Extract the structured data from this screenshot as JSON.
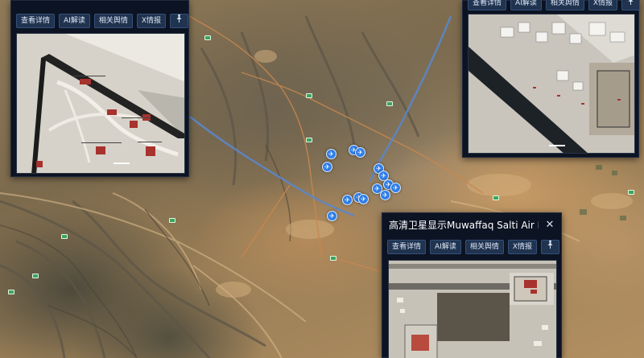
{
  "popups": {
    "top_left": {
      "title": "",
      "buttons": {
        "details": "查看详情",
        "ai": "AI解读",
        "sentiment": "相关舆情",
        "intel": "X情报"
      },
      "icons": {
        "pin": "pin-icon"
      }
    },
    "top_right": {
      "title": "",
      "buttons": {
        "details": "查看详情",
        "ai": "AI解读",
        "sentiment": "相关舆情",
        "intel": "X情报"
      },
      "icons": {
        "pin": "pin-icon"
      }
    },
    "bottom": {
      "title": "高清卫星显示Muwaffaq Salti Air Bas...",
      "close_symbol": "✕",
      "buttons": {
        "details": "查看详情",
        "ai": "AI解读",
        "sentiment": "相关舆情",
        "intel": "X情报"
      },
      "icons": {
        "pin": "pin-icon",
        "close": "close-icon"
      }
    }
  },
  "map": {
    "marker_icon": "aircraft-icon",
    "marker_symbol": "✈",
    "marker_count": 14,
    "colors": {
      "marker": "#2f7ee8",
      "road_line": "#5c86c8",
      "panel_bg": "#0c1322",
      "button_bg": "#20334f"
    }
  }
}
